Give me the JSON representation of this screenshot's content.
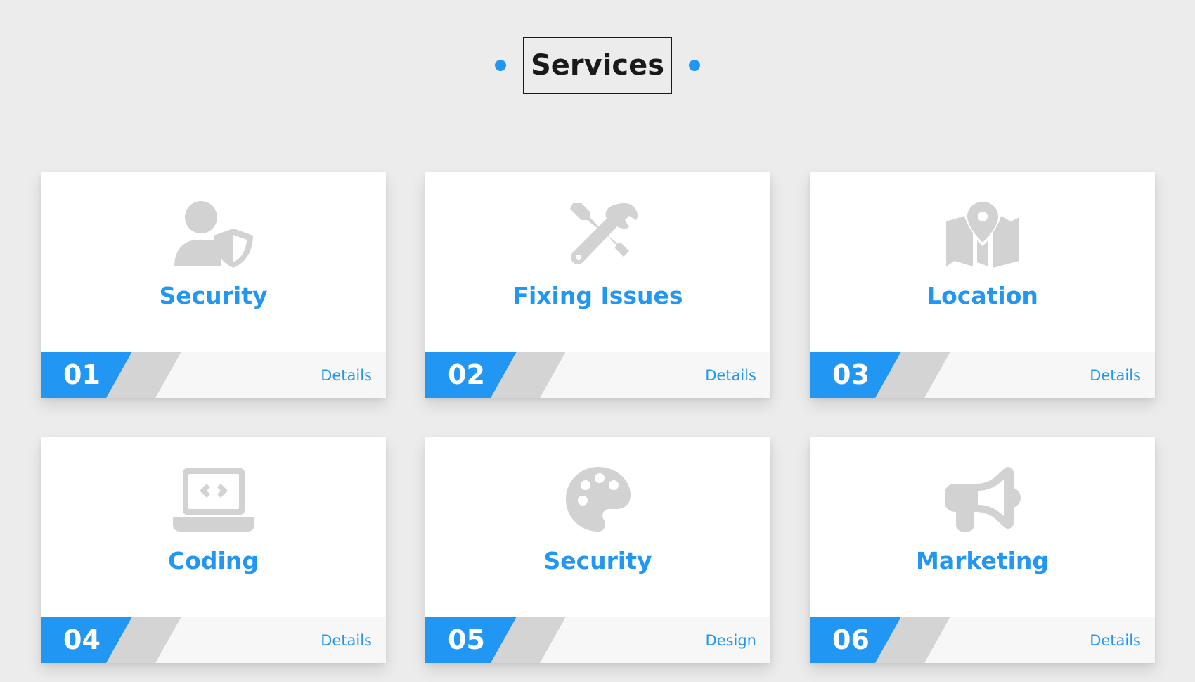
{
  "header": {
    "title": "Services"
  },
  "colors": {
    "accent": "#2196f3",
    "icon": "#d2d2d2",
    "background": "#ececec",
    "card": "#ffffff"
  },
  "cards": [
    {
      "number": "01",
      "title": "Security",
      "link": "Details",
      "icon": "user-shield-icon"
    },
    {
      "number": "02",
      "title": "Fixing Issues",
      "link": "Details",
      "icon": "screwdriver-wrench-icon"
    },
    {
      "number": "03",
      "title": "Location",
      "link": "Details",
      "icon": "map-location-icon"
    },
    {
      "number": "04",
      "title": "Coding",
      "link": "Details",
      "icon": "laptop-code-icon"
    },
    {
      "number": "05",
      "title": "Security",
      "link": "Design",
      "icon": "palette-icon"
    },
    {
      "number": "06",
      "title": "Marketing",
      "link": "Details",
      "icon": "bullhorn-icon"
    }
  ]
}
